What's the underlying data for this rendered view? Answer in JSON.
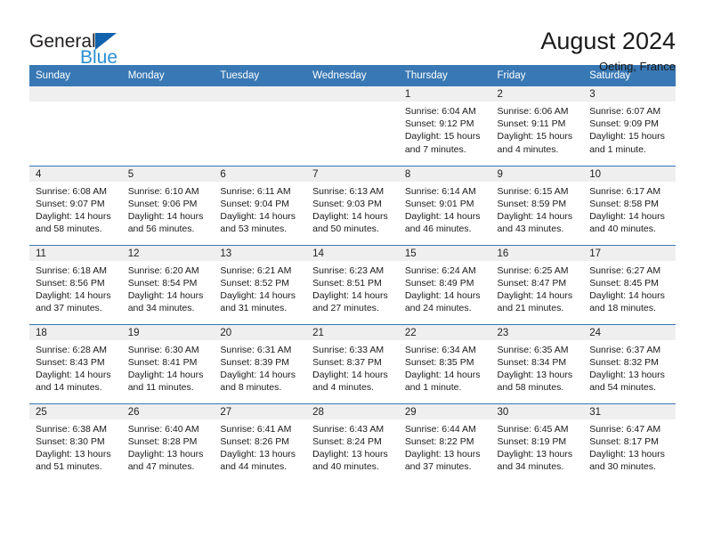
{
  "brand": {
    "name_part1": "General",
    "name_part2": "Blue",
    "triangle_color": "#1263ad",
    "blue_color": "#2a8fd4"
  },
  "header": {
    "title": "August 2024",
    "subtitle": "Oeting, France"
  },
  "colors": {
    "header_row_bg": "#3878b4",
    "daynum_band_bg": "#efefef",
    "row_divider": "#3878b4"
  },
  "weekday_headers": [
    "Sunday",
    "Monday",
    "Tuesday",
    "Wednesday",
    "Thursday",
    "Friday",
    "Saturday"
  ],
  "labels": {
    "sunrise_prefix": "Sunrise: ",
    "sunset_prefix": "Sunset: ",
    "daylight_prefix": "Daylight: "
  },
  "weeks": [
    [
      {
        "day": "",
        "sunrise": "",
        "sunset": "",
        "daylight": ""
      },
      {
        "day": "",
        "sunrise": "",
        "sunset": "",
        "daylight": ""
      },
      {
        "day": "",
        "sunrise": "",
        "sunset": "",
        "daylight": ""
      },
      {
        "day": "",
        "sunrise": "",
        "sunset": "",
        "daylight": ""
      },
      {
        "day": "1",
        "sunrise": "Sunrise: 6:04 AM",
        "sunset": "Sunset: 9:12 PM",
        "daylight": "Daylight: 15 hours and 7 minutes."
      },
      {
        "day": "2",
        "sunrise": "Sunrise: 6:06 AM",
        "sunset": "Sunset: 9:11 PM",
        "daylight": "Daylight: 15 hours and 4 minutes."
      },
      {
        "day": "3",
        "sunrise": "Sunrise: 6:07 AM",
        "sunset": "Sunset: 9:09 PM",
        "daylight": "Daylight: 15 hours and 1 minute."
      }
    ],
    [
      {
        "day": "4",
        "sunrise": "Sunrise: 6:08 AM",
        "sunset": "Sunset: 9:07 PM",
        "daylight": "Daylight: 14 hours and 58 minutes."
      },
      {
        "day": "5",
        "sunrise": "Sunrise: 6:10 AM",
        "sunset": "Sunset: 9:06 PM",
        "daylight": "Daylight: 14 hours and 56 minutes."
      },
      {
        "day": "6",
        "sunrise": "Sunrise: 6:11 AM",
        "sunset": "Sunset: 9:04 PM",
        "daylight": "Daylight: 14 hours and 53 minutes."
      },
      {
        "day": "7",
        "sunrise": "Sunrise: 6:13 AM",
        "sunset": "Sunset: 9:03 PM",
        "daylight": "Daylight: 14 hours and 50 minutes."
      },
      {
        "day": "8",
        "sunrise": "Sunrise: 6:14 AM",
        "sunset": "Sunset: 9:01 PM",
        "daylight": "Daylight: 14 hours and 46 minutes."
      },
      {
        "day": "9",
        "sunrise": "Sunrise: 6:15 AM",
        "sunset": "Sunset: 8:59 PM",
        "daylight": "Daylight: 14 hours and 43 minutes."
      },
      {
        "day": "10",
        "sunrise": "Sunrise: 6:17 AM",
        "sunset": "Sunset: 8:58 PM",
        "daylight": "Daylight: 14 hours and 40 minutes."
      }
    ],
    [
      {
        "day": "11",
        "sunrise": "Sunrise: 6:18 AM",
        "sunset": "Sunset: 8:56 PM",
        "daylight": "Daylight: 14 hours and 37 minutes."
      },
      {
        "day": "12",
        "sunrise": "Sunrise: 6:20 AM",
        "sunset": "Sunset: 8:54 PM",
        "daylight": "Daylight: 14 hours and 34 minutes."
      },
      {
        "day": "13",
        "sunrise": "Sunrise: 6:21 AM",
        "sunset": "Sunset: 8:52 PM",
        "daylight": "Daylight: 14 hours and 31 minutes."
      },
      {
        "day": "14",
        "sunrise": "Sunrise: 6:23 AM",
        "sunset": "Sunset: 8:51 PM",
        "daylight": "Daylight: 14 hours and 27 minutes."
      },
      {
        "day": "15",
        "sunrise": "Sunrise: 6:24 AM",
        "sunset": "Sunset: 8:49 PM",
        "daylight": "Daylight: 14 hours and 24 minutes."
      },
      {
        "day": "16",
        "sunrise": "Sunrise: 6:25 AM",
        "sunset": "Sunset: 8:47 PM",
        "daylight": "Daylight: 14 hours and 21 minutes."
      },
      {
        "day": "17",
        "sunrise": "Sunrise: 6:27 AM",
        "sunset": "Sunset: 8:45 PM",
        "daylight": "Daylight: 14 hours and 18 minutes."
      }
    ],
    [
      {
        "day": "18",
        "sunrise": "Sunrise: 6:28 AM",
        "sunset": "Sunset: 8:43 PM",
        "daylight": "Daylight: 14 hours and 14 minutes."
      },
      {
        "day": "19",
        "sunrise": "Sunrise: 6:30 AM",
        "sunset": "Sunset: 8:41 PM",
        "daylight": "Daylight: 14 hours and 11 minutes."
      },
      {
        "day": "20",
        "sunrise": "Sunrise: 6:31 AM",
        "sunset": "Sunset: 8:39 PM",
        "daylight": "Daylight: 14 hours and 8 minutes."
      },
      {
        "day": "21",
        "sunrise": "Sunrise: 6:33 AM",
        "sunset": "Sunset: 8:37 PM",
        "daylight": "Daylight: 14 hours and 4 minutes."
      },
      {
        "day": "22",
        "sunrise": "Sunrise: 6:34 AM",
        "sunset": "Sunset: 8:35 PM",
        "daylight": "Daylight: 14 hours and 1 minute."
      },
      {
        "day": "23",
        "sunrise": "Sunrise: 6:35 AM",
        "sunset": "Sunset: 8:34 PM",
        "daylight": "Daylight: 13 hours and 58 minutes."
      },
      {
        "day": "24",
        "sunrise": "Sunrise: 6:37 AM",
        "sunset": "Sunset: 8:32 PM",
        "daylight": "Daylight: 13 hours and 54 minutes."
      }
    ],
    [
      {
        "day": "25",
        "sunrise": "Sunrise: 6:38 AM",
        "sunset": "Sunset: 8:30 PM",
        "daylight": "Daylight: 13 hours and 51 minutes."
      },
      {
        "day": "26",
        "sunrise": "Sunrise: 6:40 AM",
        "sunset": "Sunset: 8:28 PM",
        "daylight": "Daylight: 13 hours and 47 minutes."
      },
      {
        "day": "27",
        "sunrise": "Sunrise: 6:41 AM",
        "sunset": "Sunset: 8:26 PM",
        "daylight": "Daylight: 13 hours and 44 minutes."
      },
      {
        "day": "28",
        "sunrise": "Sunrise: 6:43 AM",
        "sunset": "Sunset: 8:24 PM",
        "daylight": "Daylight: 13 hours and 40 minutes."
      },
      {
        "day": "29",
        "sunrise": "Sunrise: 6:44 AM",
        "sunset": "Sunset: 8:22 PM",
        "daylight": "Daylight: 13 hours and 37 minutes."
      },
      {
        "day": "30",
        "sunrise": "Sunrise: 6:45 AM",
        "sunset": "Sunset: 8:19 PM",
        "daylight": "Daylight: 13 hours and 34 minutes."
      },
      {
        "day": "31",
        "sunrise": "Sunrise: 6:47 AM",
        "sunset": "Sunset: 8:17 PM",
        "daylight": "Daylight: 13 hours and 30 minutes."
      }
    ]
  ]
}
